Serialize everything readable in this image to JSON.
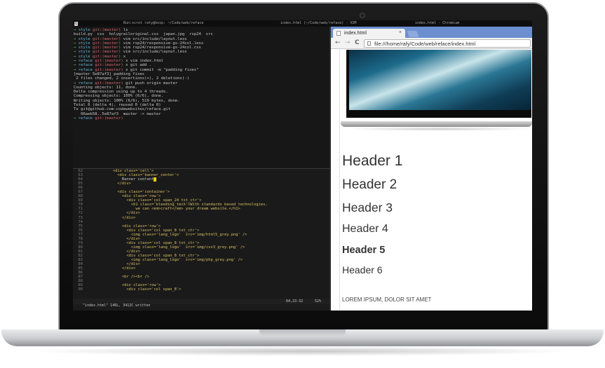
{
  "topbar": {
    "workspaces": [
      "1",
      "2",
      "3",
      "4",
      "5",
      "6",
      "7",
      "8",
      "9"
    ],
    "active_workspace": "1",
    "run_label": "Run:",
    "terminal_title": "scrot raty@bosp: ~/Code/web/reface",
    "vim_title": "index.html (~/Code/web/reface) - VIM",
    "chromium_title": "index.html - Chromium"
  },
  "terminal": {
    "lines": [
      {
        "prompt": "→ ",
        "dir": "style ",
        "branch": "git:(master) ",
        "cmd": "ls"
      },
      {
        "output": "build.py  css  holygrailoriginal.css  japan.jpg  rsp24  src"
      },
      {
        "prompt": "→ ",
        "dir": "style ",
        "branch": "git:(master) ",
        "cmd": "vim src/include/layout.less"
      },
      {
        "prompt": "→ ",
        "dir": "style ",
        "branch": "git:(master) ",
        "cmd": "vim rsp24/responsive-gs-24col.less"
      },
      {
        "prompt": "→ ",
        "dir": "style ",
        "branch": "git:(master) ",
        "cmd": "vim rsp24/responsive-gs-24col.css"
      },
      {
        "prompt": "→ ",
        "dir": "style ",
        "branch": "git:(master) ",
        "cmd": "vim src/include/layout.less"
      },
      {
        "prompt": "→ ",
        "dir": "style ",
        "branch": "git:(master) ",
        "cmd": "x"
      },
      {
        "prompt": "→ ",
        "dir": "reface ",
        "branch": "git:(master) ",
        "cmd": "x vim index.html"
      },
      {
        "prompt": "→ ",
        "dir": "reface ",
        "branch": "git:(master) ",
        "cmd": "x git add ."
      },
      {
        "prompt": "→ ",
        "dir": "reface ",
        "branch": "git:(master) ",
        "cmd": "x git commit -m \"padding fixes\""
      },
      {
        "output": "[master 5e87af3] padding fixes"
      },
      {
        "output": " 2 files changed, 2 insertions(+), 2 deletions(-)"
      },
      {
        "prompt": "→ ",
        "dir": "reface ",
        "branch": "git:(master) ",
        "cmd": "git push origin master"
      },
      {
        "output": "Counting objects: 11, done."
      },
      {
        "output": "Delta compression using up to 4 threads."
      },
      {
        "output": "Compressing objects: 100% (6/6), done."
      },
      {
        "output": "Writing objects: 100% (6/6), 519 bytes, done."
      },
      {
        "output": "Total 6 (delta 4), reused 0 (delta 0)"
      },
      {
        "output": "To git@github.com:codewebsites/reface.git"
      },
      {
        "output": "   06aeb58..5e87af3  master -> master"
      },
      {
        "prompt": "→ ",
        "dir": "reface ",
        "branch": "git:(master) ",
        "cmd": ""
      }
    ]
  },
  "vim": {
    "lines": [
      {
        "n": "62",
        "code": "            <div class='cell'>"
      },
      {
        "n": "63",
        "code": "              <div class='banner_center'>"
      },
      {
        "n": "64",
        "code": "                Banner content",
        "cursor": true
      },
      {
        "n": "65",
        "code": "              </div>"
      },
      {
        "n": "66",
        "code": ""
      },
      {
        "n": "67",
        "code": "              <div class='container'>"
      },
      {
        "n": "68",
        "code": "                <div class='row'>"
      },
      {
        "n": "69",
        "code": "                  <div class='col span_24 txt_ctr'>"
      },
      {
        "n": "70",
        "code": "                    <h1 class='bleeding_tech'>With standards based technologies,"
      },
      {
        "n": "71",
        "code": "                      we can <em>craft</em> your dream website.</h1>"
      },
      {
        "n": "72",
        "code": "                  </div>"
      },
      {
        "n": "73",
        "code": "                </div>"
      },
      {
        "n": "74",
        "code": ""
      },
      {
        "n": "75",
        "code": "                <div class='row'>"
      },
      {
        "n": "76",
        "code": "                  <div class='col span_8 txt_ctr'>"
      },
      {
        "n": "77",
        "code": "                    <img class='lang_logo'  src='img/html5_grey.png' />"
      },
      {
        "n": "78",
        "code": "                  </div>"
      },
      {
        "n": "79",
        "code": "                  <div class='col span_8 txt_ctr'>"
      },
      {
        "n": "80",
        "code": "                    <img class='lang_logo'  src='img/css3_grey.png' />"
      },
      {
        "n": "81",
        "code": "                  </div>"
      },
      {
        "n": "82",
        "code": "                  <div class='col span_8 txt_ctr'>"
      },
      {
        "n": "83",
        "code": "                    <img class='lang_logo'  src='img/php_grey.png' />"
      },
      {
        "n": "84",
        "code": "                  </div>"
      },
      {
        "n": "85",
        "code": "                </div>"
      },
      {
        "n": "86",
        "code": ""
      },
      {
        "n": "87",
        "code": "                <br /><br />"
      },
      {
        "n": "88",
        "code": ""
      },
      {
        "n": "89",
        "code": "                <div class='row'>"
      },
      {
        "n": "90",
        "code": "                  <div class='col span_8'>"
      }
    ],
    "status_left": "\"index.html\" 146L, 3412C written",
    "status_pos": "64,23-32",
    "status_pct": "52%"
  },
  "browser": {
    "tab_title": "index.html",
    "tab_close": "×",
    "back": "←",
    "forward": "→",
    "reload": "C",
    "url": "file:///home/rafy/Code/web/reface/index.html",
    "headers": [
      "Header 1",
      "Header 2",
      "Header 3",
      "Header 4",
      "Header 5",
      "Header 6"
    ],
    "lorem": "LOREM IPSUM, DOLOR SIT AMET"
  }
}
